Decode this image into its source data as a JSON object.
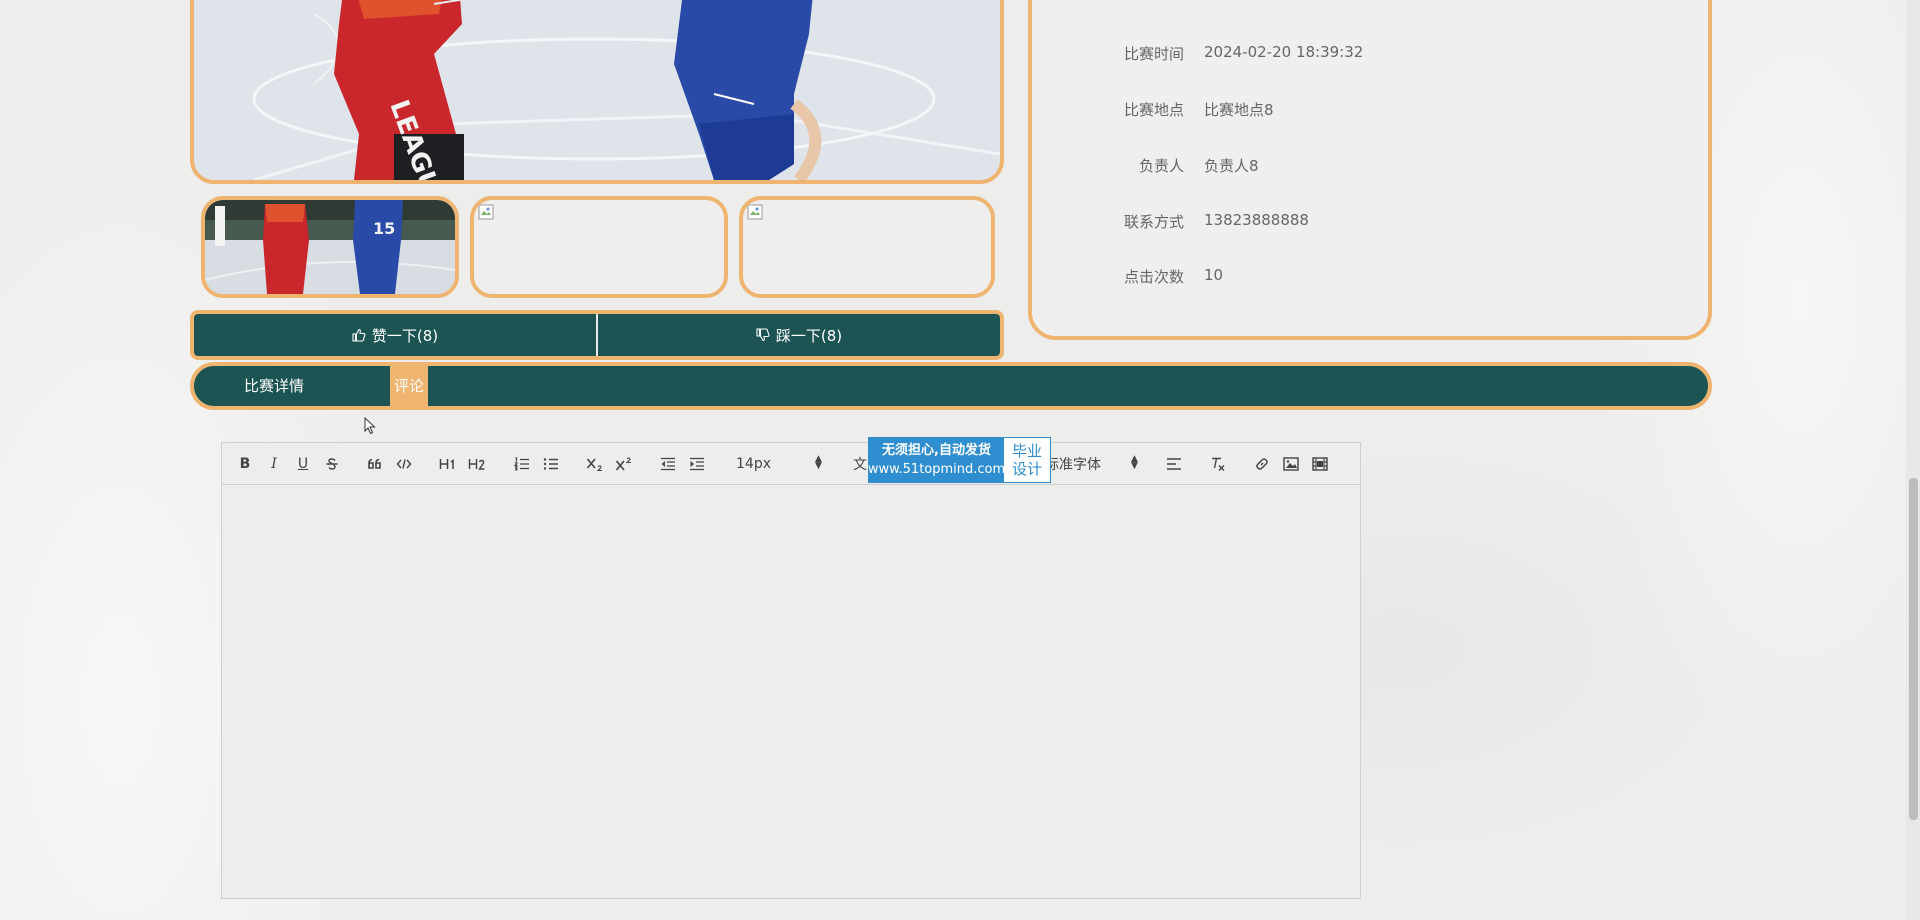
{
  "info": {
    "rows": [
      {
        "label": "比赛时间",
        "value": "2024-02-20 18:39:32"
      },
      {
        "label": "比赛地点",
        "value": "比赛地点8"
      },
      {
        "label": "负责人",
        "value": "负责人8"
      },
      {
        "label": "联系方式",
        "value": "13823888888"
      },
      {
        "label": "点击次数",
        "value": "10"
      }
    ]
  },
  "vote": {
    "like_label": "赞一下(8)",
    "dislike_label": "踩一下(8)"
  },
  "tabs": {
    "detail": "比赛详情",
    "comment": "评论"
  },
  "editor": {
    "font_size": "14px",
    "header_partial": "文",
    "font_family": "标准字体"
  },
  "watermark": {
    "line1": "无须担心,自动发货",
    "url": "www.51topmind.com",
    "right1": "毕业",
    "right2": "设计"
  },
  "photo_text": {
    "jersey": "LEAGUE",
    "jersey_number": "15"
  },
  "colors": {
    "accent": "#efb46f",
    "primary": "#1b5452",
    "watermark_blue": "#2e8ecf"
  }
}
